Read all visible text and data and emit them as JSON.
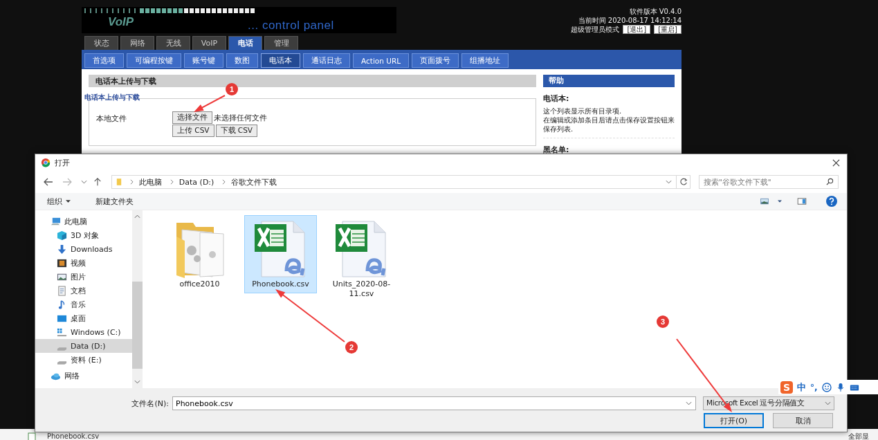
{
  "web_page": {
    "logo": {
      "title": "VoIP",
      "subtitle": "... control panel"
    },
    "info": {
      "version": "软件版本 V0.4.0",
      "time": "当前时间 2020-08-17 14:12:14",
      "mode": "超级管理员模式",
      "buttons": [
        "[退出]",
        "[重启]"
      ]
    },
    "tabs": [
      {
        "label": "状态",
        "selected": false
      },
      {
        "label": "网络",
        "selected": false
      },
      {
        "label": "无线",
        "selected": false
      },
      {
        "label": "VoIP",
        "selected": false
      },
      {
        "label": "电话",
        "selected": true
      },
      {
        "label": "管理",
        "selected": false
      }
    ],
    "subtabs": [
      {
        "label": "首选项",
        "selected": false
      },
      {
        "label": "可编程按键",
        "selected": false
      },
      {
        "label": "账号键",
        "selected": false
      },
      {
        "label": "数图",
        "selected": false
      },
      {
        "label": "电话本",
        "selected": true
      },
      {
        "label": "通话日志",
        "selected": false
      },
      {
        "label": "Action URL",
        "selected": false
      },
      {
        "label": "页面拨号",
        "selected": false
      },
      {
        "label": "组播地址",
        "selected": false
      }
    ],
    "section_title": "电话本上传与下载",
    "fieldset": {
      "legend": "电话本上传与下载",
      "label": "本地文件",
      "choose_button": "选择文件",
      "file_status": "未选择任何文件",
      "buttons": [
        "上传 CSV",
        "下载 CSV"
      ]
    },
    "help": {
      "title": "帮助",
      "heading": "电话本:",
      "text": "这个列表显示所有目录项.\n在编辑或添加条目后请点击保存设置按钮来保存列表.",
      "heading_2": "黑名单:"
    }
  },
  "dialog": {
    "title": "打开",
    "path": [
      "此电脑",
      "Data (D:)",
      "谷歌文件下载"
    ],
    "search": {
      "placeholder": "搜索\"谷歌文件下载\""
    },
    "toolbar": {
      "organize": "组织",
      "new_folder": "新建文件夹"
    },
    "nav": [
      {
        "label": "此电脑",
        "kind": "pc",
        "selected": false,
        "children": [
          {
            "label": "3D 对象",
            "kind": "cube",
            "selected": false
          },
          {
            "label": "Downloads",
            "kind": "download",
            "selected": false
          },
          {
            "label": "视频",
            "kind": "video",
            "selected": false
          },
          {
            "label": "图片",
            "kind": "picture",
            "selected": false
          },
          {
            "label": "文档",
            "kind": "document",
            "selected": false
          },
          {
            "label": "音乐",
            "kind": "music",
            "selected": false
          },
          {
            "label": "桌面",
            "kind": "desktop",
            "selected": false
          },
          {
            "label": "Windows (C:)",
            "kind": "windows-drive",
            "selected": false
          },
          {
            "label": "Data (D:)",
            "kind": "drive",
            "selected": true
          },
          {
            "label": "资料 (E:)",
            "kind": "drive",
            "selected": false
          }
        ]
      },
      {
        "label": "网络",
        "kind": "network",
        "selected": false
      }
    ],
    "files": [
      {
        "name": "office2010",
        "kind": "folder",
        "selected": false
      },
      {
        "name": "Phonebook.csv",
        "kind": "csv",
        "selected": true
      },
      {
        "name": "Units_2020-08-11.csv",
        "kind": "csv",
        "selected": false
      }
    ],
    "filename": {
      "label": "文件名(N):",
      "value": "Phonebook.csv"
    },
    "filetype": "Microsoft Excel 逗号分隔值文",
    "buttons": [
      {
        "label": "打开(O)",
        "default": true
      },
      {
        "label": "取消",
        "default": false
      }
    ]
  },
  "ime": {
    "logo": "S",
    "mode": "中",
    "punct": "°,"
  },
  "download_bar": {
    "file": "Phonebook.csv",
    "show_all": "全部显"
  },
  "annotations": [
    {
      "label": "1"
    },
    {
      "label": "2"
    },
    {
      "label": "3"
    }
  ]
}
